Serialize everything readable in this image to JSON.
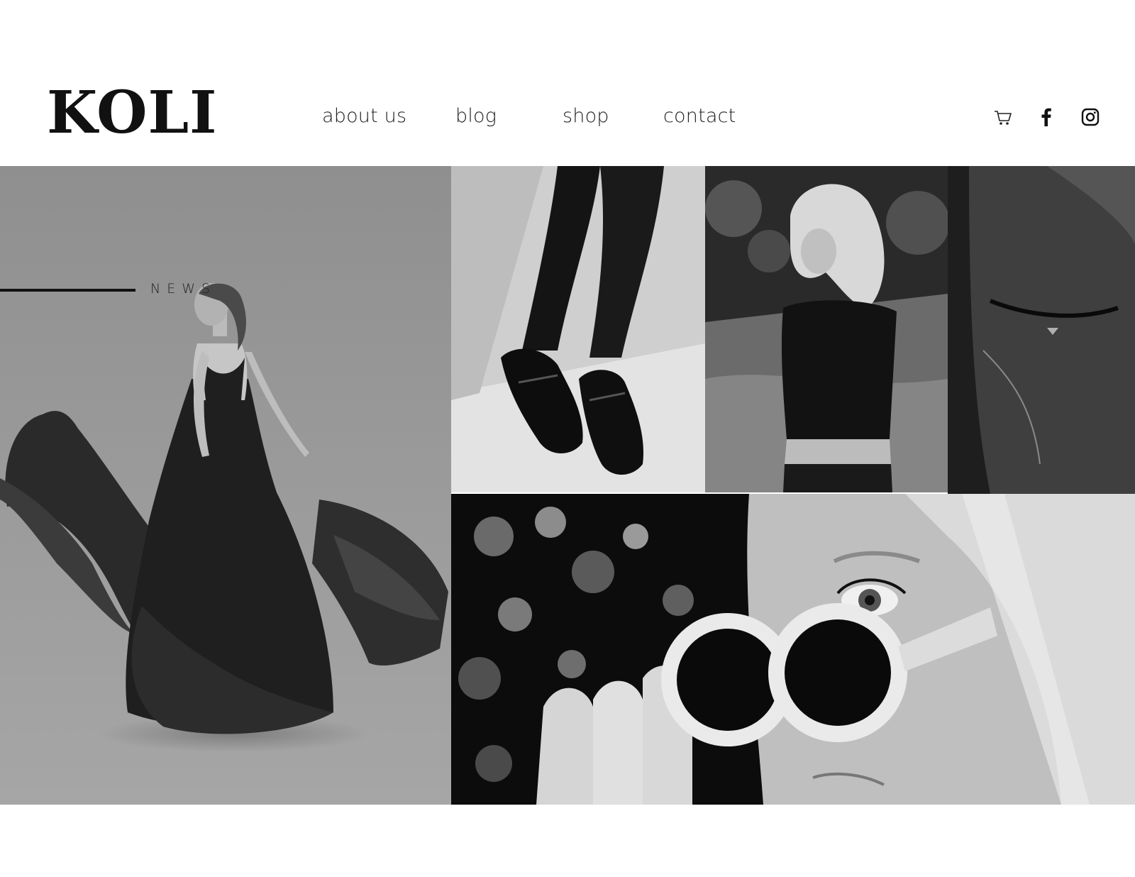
{
  "header": {
    "logo": "KOLI",
    "nav": [
      "about us",
      "blog",
      "shop",
      "contact"
    ],
    "icons": [
      "cart-icon",
      "facebook-icon",
      "instagram-icon"
    ]
  },
  "hero": {
    "section_label": "NEWS"
  },
  "colors": {
    "text": "#111111",
    "background": "#ffffff"
  }
}
